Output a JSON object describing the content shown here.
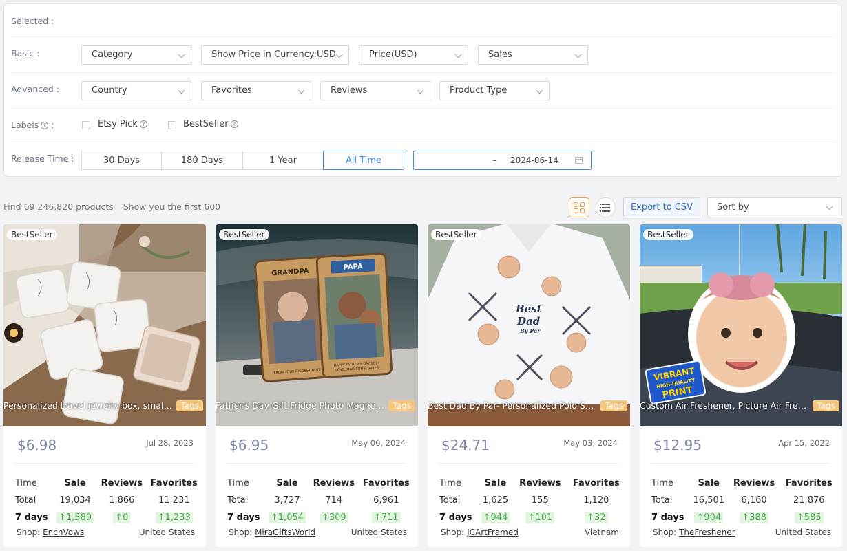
{
  "filters": {
    "selected_label": "Selected :",
    "basic_label": "Basic :",
    "basic": [
      "Category",
      "Show Price in Currency:USD",
      "Price(USD)",
      "Sales"
    ],
    "advanced_label": "Advanced :",
    "advanced": [
      "Country",
      "Favorites",
      "Reviews",
      "Product Type"
    ],
    "labels_label": "Labels",
    "labels_colon": ":",
    "labels": [
      "Etsy Pick",
      "BestSeller"
    ],
    "release_label": "Release Time :",
    "release_options": [
      "30 Days",
      "180 Days",
      "1 Year",
      "All Time"
    ],
    "release_selected": "All Time",
    "date_dash": "–",
    "date_end": "2024-06-14"
  },
  "results": {
    "count_text": "Find 69,246,820 products",
    "shown_text": "Show you the first 600",
    "export_label": "Export to CSV",
    "sort_placeholder": "Sort by"
  },
  "stats_headers": [
    "Time",
    "Sale",
    "Reviews",
    "Favorites"
  ],
  "products": [
    {
      "badge": "BestSeller",
      "title": "Personalized travel jewelry box, small ...",
      "tags_label": "Tags",
      "price": "$6.98",
      "date": "Jul 28, 2023",
      "total_label": "Total",
      "total": [
        "19,034",
        "1,866",
        "11,231"
      ],
      "week_label": "7 days",
      "week": [
        "↑1,589",
        "↑0",
        "↑1,233"
      ],
      "shop_label": "Shop:",
      "shop": "EnchVows",
      "country": "United States"
    },
    {
      "badge": "BestSeller",
      "title": "Father's Day Gift Fridge Photo Magnet...",
      "tags_label": "Tags",
      "price": "$6.95",
      "date": "May 06, 2024",
      "total_label": "Total",
      "total": [
        "3,727",
        "714",
        "6,961"
      ],
      "week_label": "7 days",
      "week": [
        "↑1,054",
        "↑309",
        "↑711"
      ],
      "shop_label": "Shop:",
      "shop": "MiraGiftsWorld",
      "country": "United States"
    },
    {
      "badge": "BestSeller",
      "title": "Best Dad By Par- Personalized Polo Sh...",
      "tags_label": "Tags",
      "price": "$24.71",
      "date": "May 03, 2024",
      "total_label": "Total",
      "total": [
        "1,625",
        "155",
        "1,120"
      ],
      "week_label": "7 days",
      "week": [
        "↑944",
        "↑101",
        "↑32"
      ],
      "shop_label": "Shop:",
      "shop": "JCArtFramed",
      "country": "Vietnam"
    },
    {
      "badge": "BestSeller",
      "title": "Custom Air Freshener, Picture Air Fres...",
      "tags_label": "Tags",
      "price": "$12.95",
      "date": "Apr 15, 2022",
      "total_label": "Total",
      "total": [
        "16,501",
        "6,160",
        "21,876"
      ],
      "week_label": "7 days",
      "week": [
        "↑904",
        "↑388",
        "↑585"
      ],
      "shop_label": "Shop:",
      "shop": "TheFreshener",
      "country": "United States"
    }
  ],
  "image_text": {
    "polo_words": [
      "Best",
      "Dad",
      "By Par"
    ],
    "fridge_words": [
      "GRANDPA",
      "PAPA",
      "HAPPY FATHER'S DAY 2024",
      "LOVE, MADISON & JAMES",
      "FROM YOUR BIGGEST FANS"
    ],
    "freshener_words": [
      "VIBRANT",
      "HIGH-QUALITY",
      "PRINT"
    ]
  },
  "icons": {
    "grid_view": "grid-icon",
    "list_view": "list-icon",
    "calendar": "calendar-icon",
    "help": "question-circle-icon",
    "dropdown": "chevron-down-icon"
  },
  "colors": {
    "accent": "#3d8ee8",
    "tag": "#f6c67e",
    "grid_active": "#f0a040",
    "up_text": "#4caf50",
    "up_bg": "#e3f5e0",
    "price": "#7b86a6"
  }
}
